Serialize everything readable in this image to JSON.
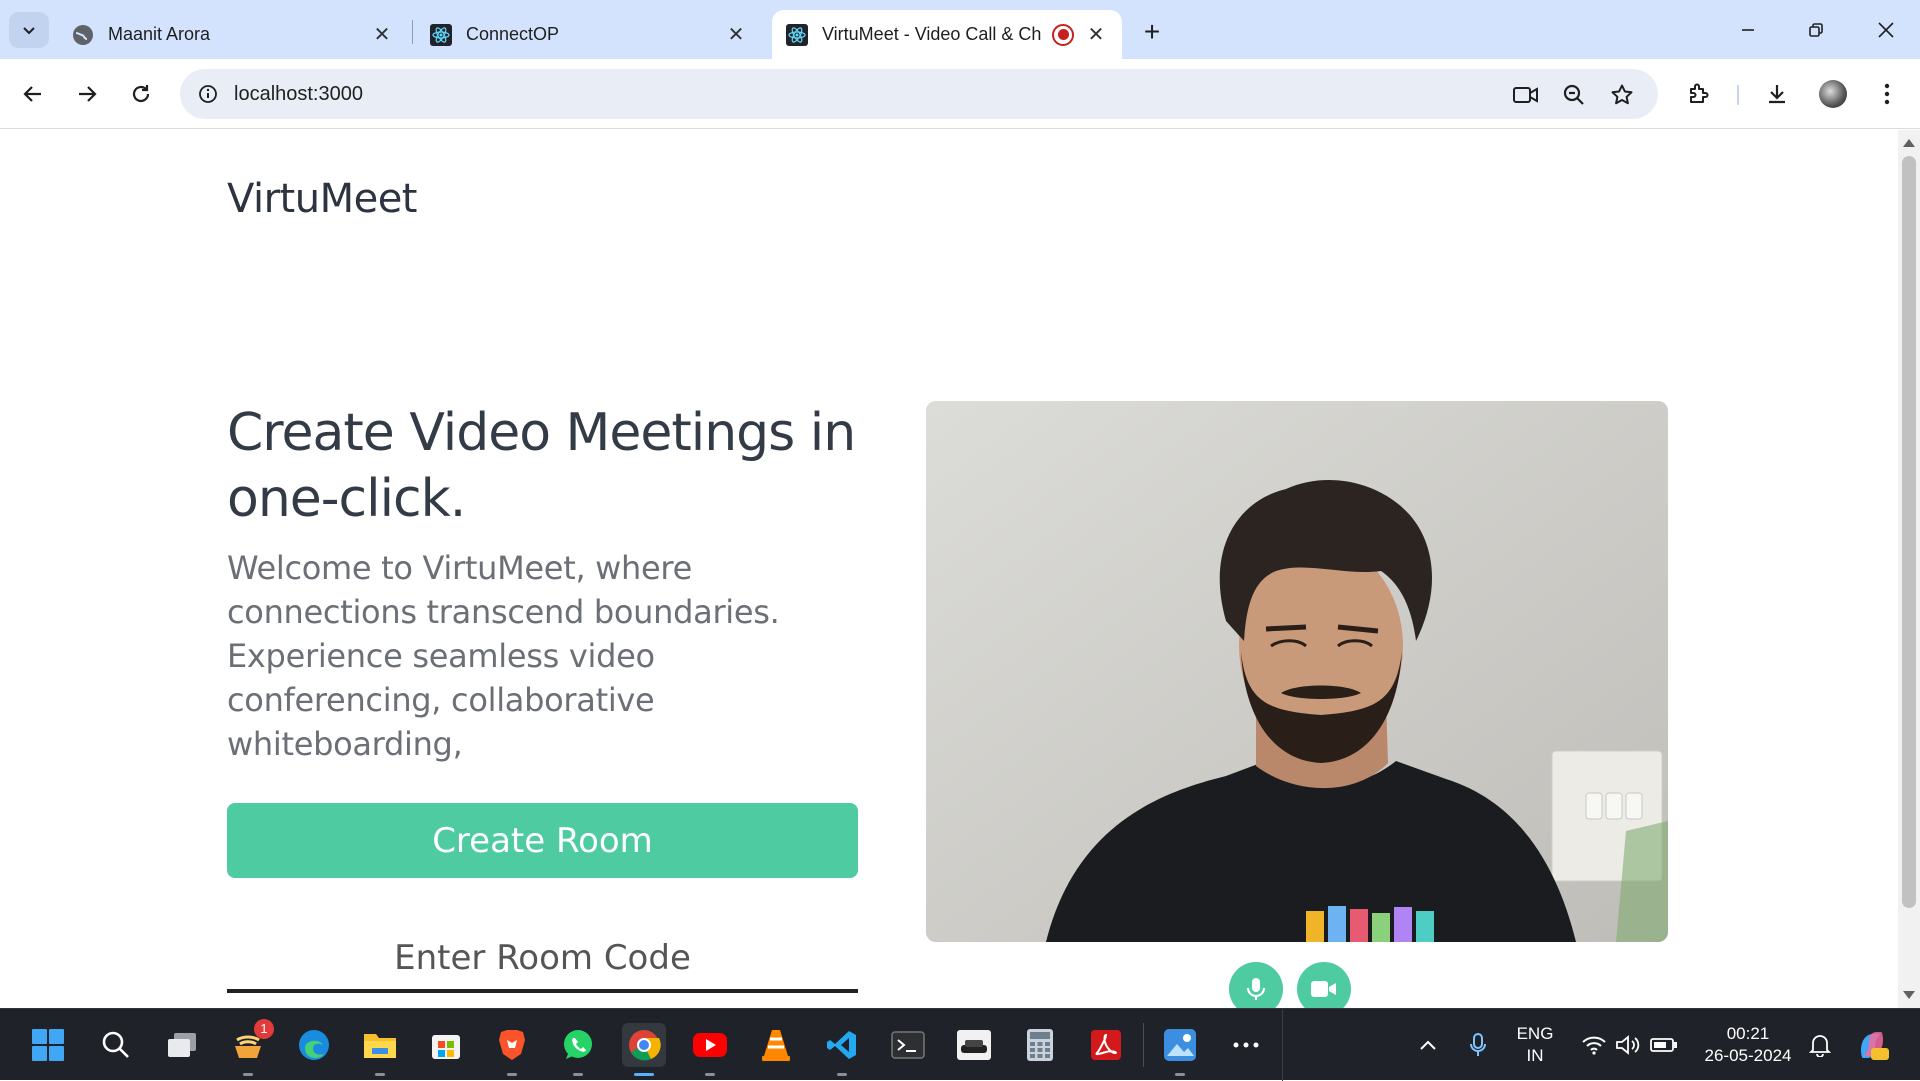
{
  "browser": {
    "tabs": [
      {
        "title": "Maanit Arora",
        "active": false
      },
      {
        "title": "ConnectOP",
        "active": false
      },
      {
        "title": "VirtuMeet - Video Call & Ch",
        "active": true
      }
    ],
    "url": "localhost:3000"
  },
  "page": {
    "brand": "VirtuMeet",
    "hero_title": "Create Video Meetings in one-click.",
    "hero_description": "Welcome to VirtuMeet, where connections transcend boundaries. Experience seamless video conferencing, collaborative whiteboarding,",
    "create_button": "Create Room",
    "room_code_placeholder": "Enter Room Code"
  },
  "colors": {
    "accent": "#4ecba1",
    "tabstrip": "#d3e3fd",
    "taskbar": "#1f2228"
  },
  "taskbar": {
    "apps": [
      "start-icon",
      "search-icon",
      "task-view-icon",
      "cloud-app-icon",
      "edge-icon",
      "file-explorer-icon",
      "store-icon",
      "brave-icon",
      "whatsapp-icon",
      "chrome-icon",
      "youtube-icon",
      "vlc-icon",
      "vscode-icon",
      "terminal-icon",
      "game-app-icon",
      "calculator-icon",
      "acrobat-icon",
      "photos-icon",
      "more-icon"
    ],
    "badge_count": "1",
    "language": "ENG",
    "region": "IN",
    "time": "00:21",
    "date": "26-05-2024"
  }
}
